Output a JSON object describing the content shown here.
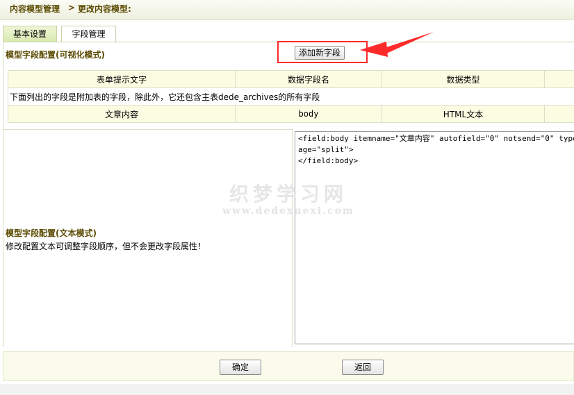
{
  "breadcrumb": {
    "item1": "内容模型管理",
    "separator": ">",
    "item2": "更改内容模型:"
  },
  "tabs": [
    {
      "label": "基本设置"
    },
    {
      "label": "字段管理"
    }
  ],
  "visual_section": {
    "title": "模型字段配置(可视化模式)",
    "add_button": "添加新字段"
  },
  "fields_table": {
    "headers": [
      "表单提示文字",
      "数据字段名",
      "数据类型"
    ],
    "note": "下面列出的字段是附加表的字段，除此外，它还包含主表dede_archives的所有字段",
    "rows": [
      {
        "label": "文章内容",
        "field": "body",
        "type": "HTML文本"
      }
    ]
  },
  "text_section": {
    "title": "模型字段配置(文本模式)",
    "description": "修改配置文本可调整字段顺序，但不会更改字段属性！",
    "config_text": "<field:body itemname=\"文章内容\" autofield=\"0\" notsend=\"0\" type=\"htm\nage=\"split\">\n</field:body>"
  },
  "watermark": {
    "name": "织梦学习网",
    "url": "www.dedexuexi.com"
  },
  "footer": {
    "confirm": "确定",
    "back": "返回"
  },
  "colors": {
    "highlight": "#ff2a2a",
    "title": "#5a4a00",
    "table_bg": "#fbfce2"
  }
}
